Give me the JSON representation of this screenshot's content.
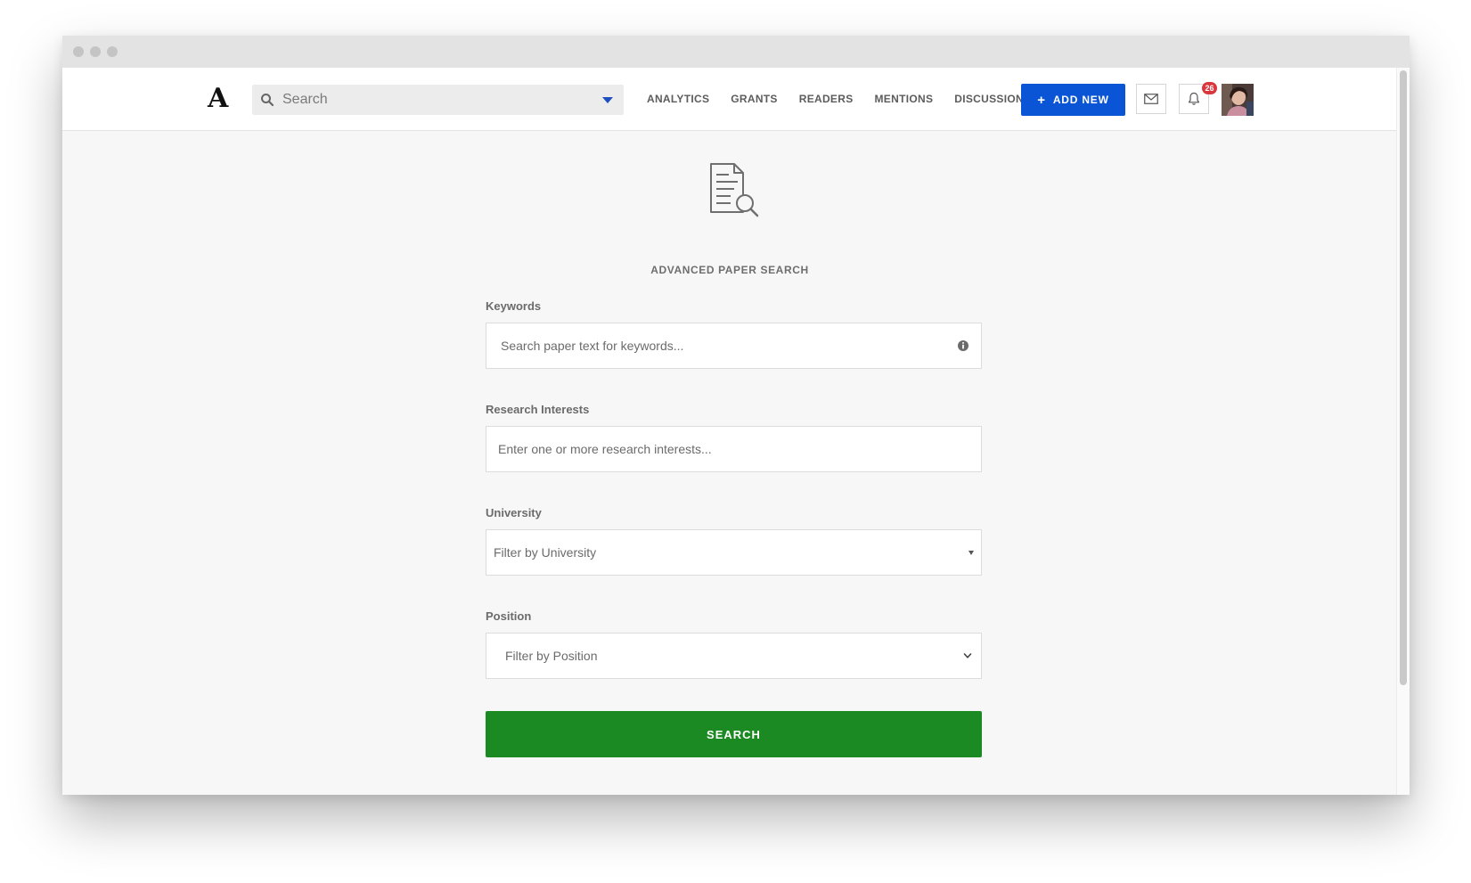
{
  "header": {
    "logo_text": "A",
    "search": {
      "placeholder": "Search",
      "value": ""
    },
    "nav": [
      {
        "label": "ANALYTICS"
      },
      {
        "label": "GRANTS"
      },
      {
        "label": "READERS"
      },
      {
        "label": "MENTIONS"
      },
      {
        "label": "DISCUSSIONS"
      }
    ],
    "add_new_label": "ADD NEW",
    "notification_count": "26"
  },
  "page": {
    "title": "ADVANCED PAPER SEARCH"
  },
  "form": {
    "keywords": {
      "label": "Keywords",
      "placeholder": "Search paper text for keywords...",
      "value": ""
    },
    "research_interests": {
      "label": "Research Interests",
      "placeholder": "Enter one or more research interests...",
      "value": ""
    },
    "university": {
      "label": "University",
      "selected": "Filter by University"
    },
    "position": {
      "label": "Position",
      "selected": "Filter by Position"
    },
    "submit_label": "SEARCH"
  },
  "colors": {
    "accent_blue": "#0a55d6",
    "search_green": "#1c8a22",
    "badge_red": "#d9363e"
  },
  "icons": {
    "search": "search-icon",
    "dropdown": "caret-down-icon",
    "mail": "mail-icon",
    "bell": "bell-icon",
    "document_search": "document-search-icon",
    "info": "info-icon"
  }
}
